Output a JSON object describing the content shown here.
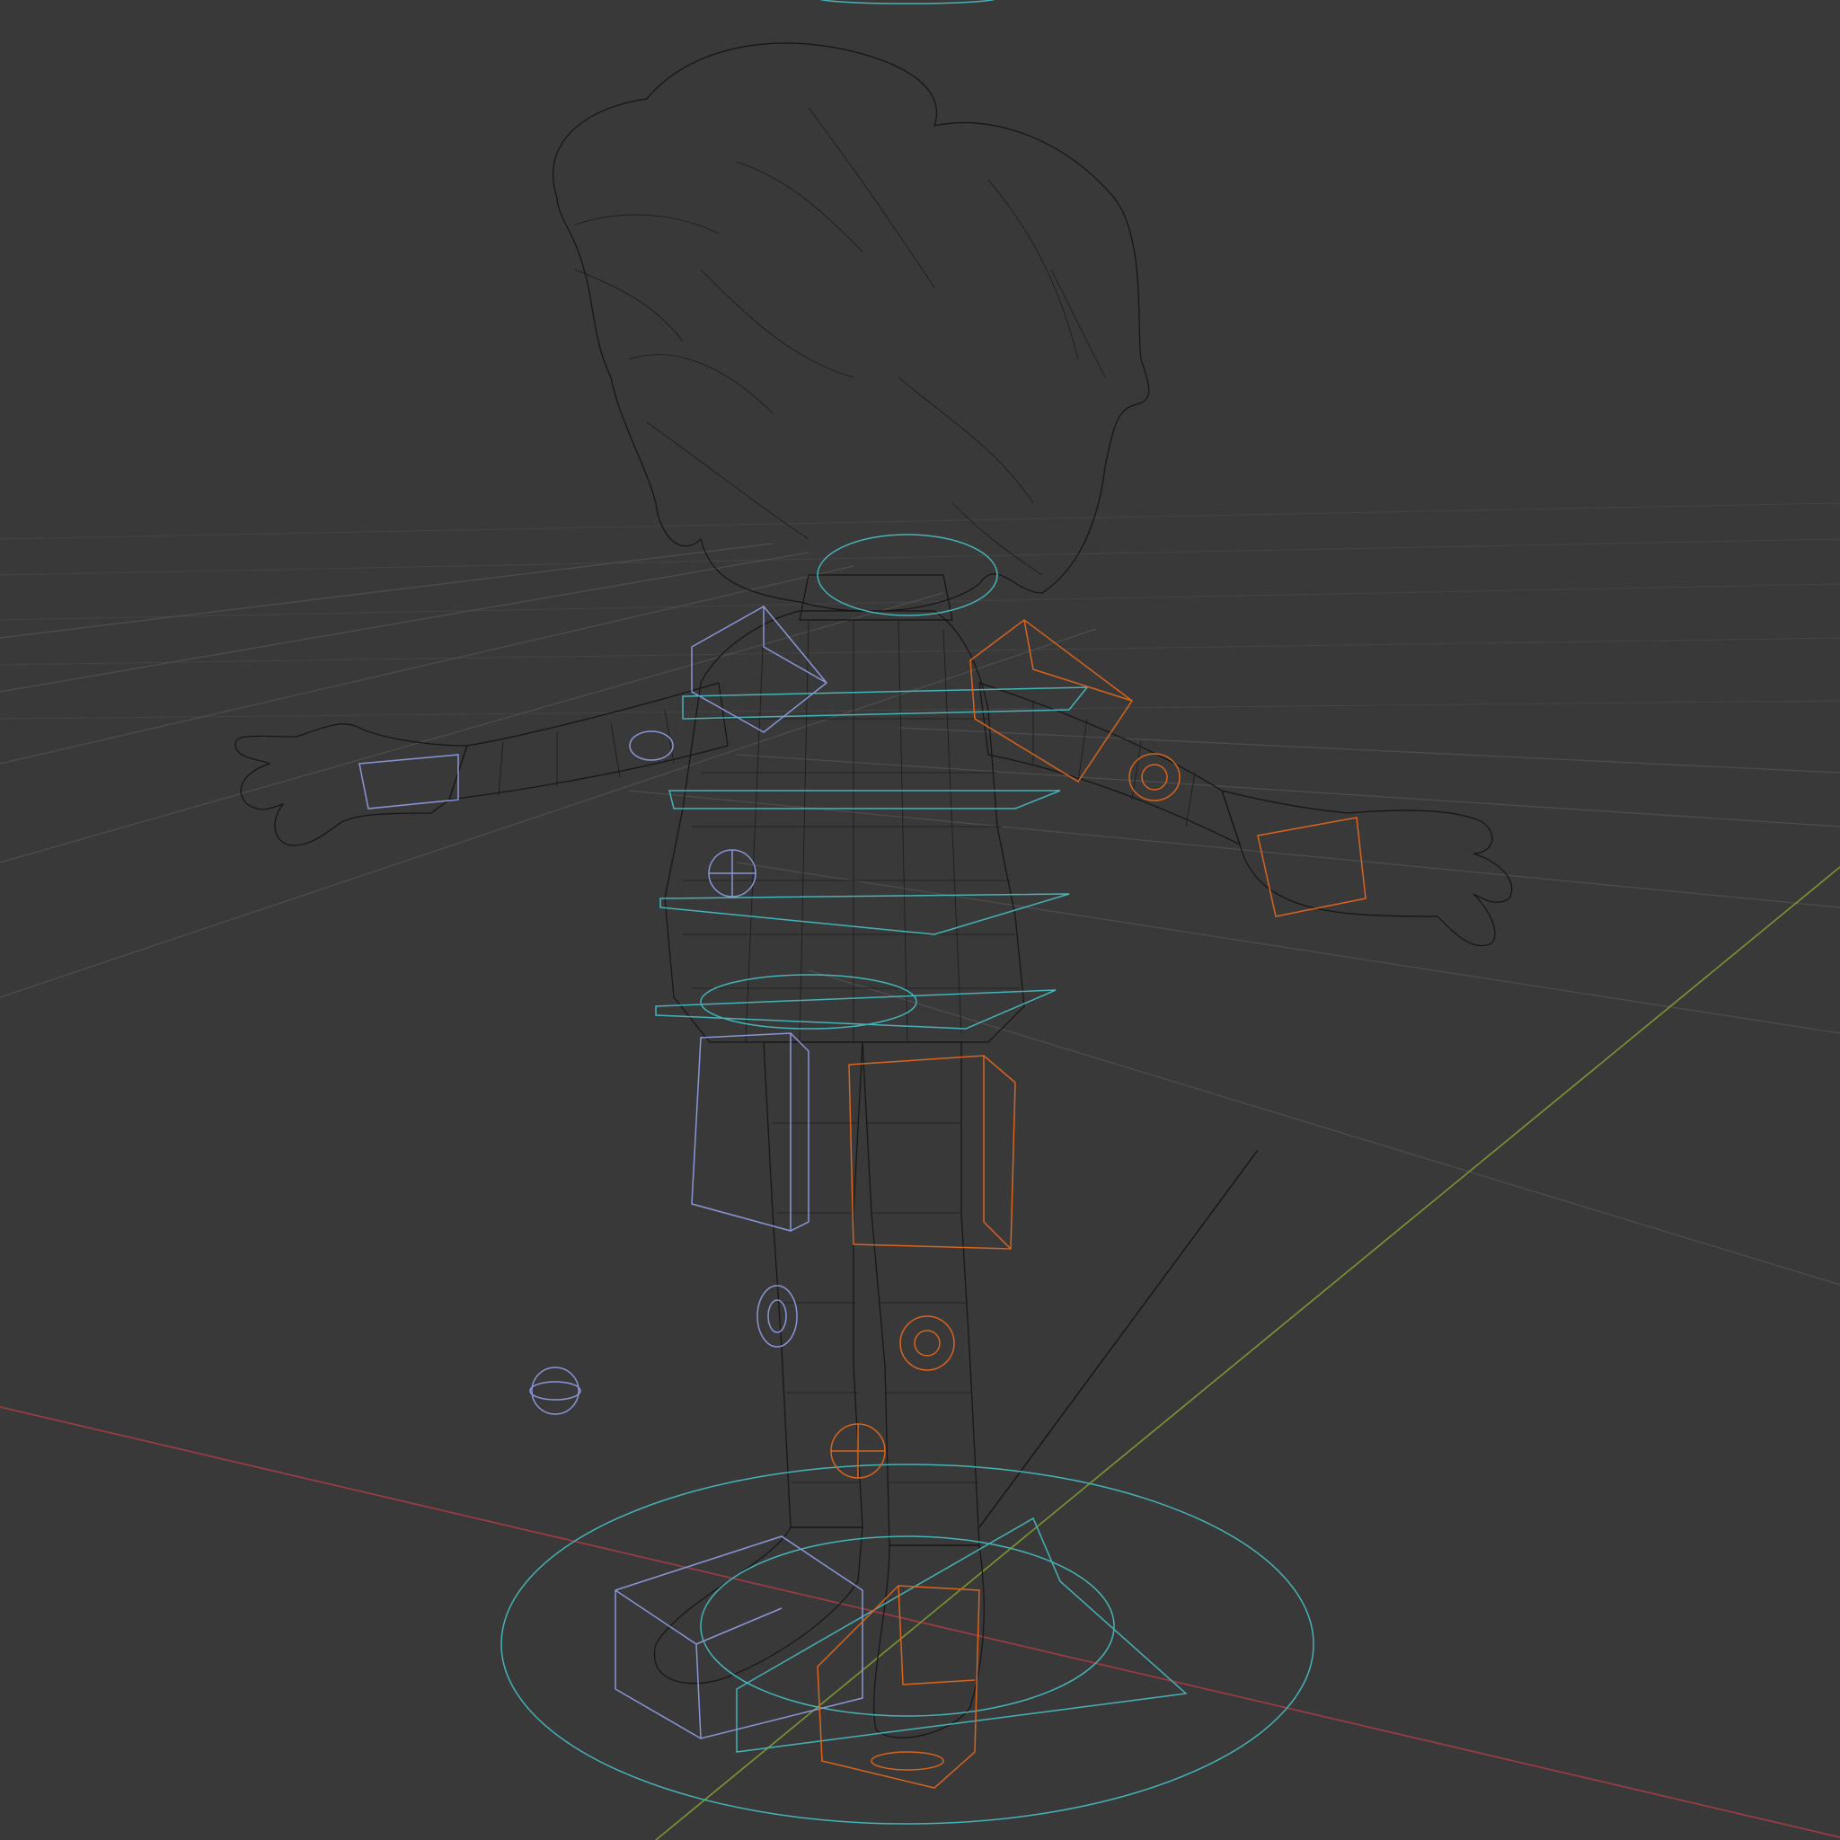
{
  "viewport": {
    "mode": "wireframe",
    "background_color": "#393939",
    "object": "character-mesh",
    "colors": {
      "grid": "#4e4e4e",
      "x_axis": "#a03c44",
      "y_axis": "#7b9632",
      "mesh_wire": "#151515",
      "controls_left": "#8a96d6",
      "controls_right": "#d8641e",
      "controls_center": "#45b3b8"
    },
    "rig_controls": {
      "left_side_color": "#8a96d6",
      "right_side_color": "#d8641e",
      "center_color": "#45b3b8"
    }
  }
}
